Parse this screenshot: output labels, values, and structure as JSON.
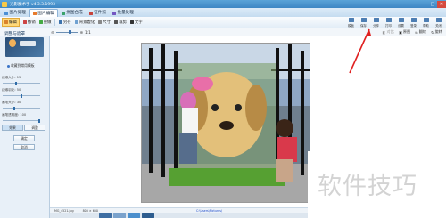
{
  "app": {
    "title": "光影魔术手 v4.3.3.1993"
  },
  "window_controls": {
    "minimize": "–",
    "maximize": "□",
    "close": "✕"
  },
  "menu_tabs": [
    {
      "label": "图片处理",
      "icon": "picture-icon",
      "active": false
    },
    {
      "label": "图片编辑",
      "icon": "edit-icon",
      "active": true
    },
    {
      "label": "拼图合成",
      "icon": "collage-icon",
      "active": false
    },
    {
      "label": "证件照",
      "icon": "id-photo-icon",
      "active": false
    },
    {
      "label": "批量处理",
      "icon": "batch-icon",
      "active": false
    }
  ],
  "toolbar": {
    "items": [
      {
        "label": "编辑",
        "active": true
      },
      {
        "label": "撤销"
      },
      {
        "label": "重做"
      },
      {
        "label": "另存"
      },
      {
        "label": "背景虚化"
      },
      {
        "label": "尺寸"
      },
      {
        "label": "裁剪"
      },
      {
        "label": "文字"
      }
    ]
  },
  "right_tools": [
    {
      "label": "模板"
    },
    {
      "label": "保存"
    },
    {
      "label": "分享"
    },
    {
      "label": "打印"
    },
    {
      "label": "设置"
    },
    {
      "label": "登录"
    },
    {
      "label": "帮助"
    },
    {
      "label": "关闭"
    }
  ],
  "subbar": {
    "zoom_label": "1:1",
    "buttons": [
      {
        "label": "对比",
        "dim": true
      },
      {
        "label": "原图",
        "dim": false
      },
      {
        "label": "翻转",
        "dim": false
      },
      {
        "label": "旋转",
        "dim": false
      }
    ]
  },
  "sidebar": {
    "panel_title": "调整与遮罩",
    "favorite_label": "收藏到常用模板",
    "params": [
      {
        "label": "边缘大小: 15",
        "value": 0.35
      },
      {
        "label": "边缘羽化: 50",
        "value": 0.5
      },
      {
        "label": "画笔大小: 30",
        "value": 0.3
      },
      {
        "label": "画笔透明度: 100",
        "value": 1.0
      }
    ],
    "mode_tabs": [
      {
        "label": "效果",
        "active": true
      },
      {
        "label": "调整",
        "active": false
      }
    ],
    "buttons": {
      "apply": "确定",
      "cancel": "取消"
    }
  },
  "status": {
    "file": "IMG_4521.jpg",
    "size": "800 × 600",
    "path": "C:\\Users\\Pictures\\"
  },
  "watermark": {
    "text": "软件技巧"
  },
  "colors": {
    "accent": "#3d86c4",
    "active_tab": "#ffd97a",
    "arrow": "#e02020"
  }
}
